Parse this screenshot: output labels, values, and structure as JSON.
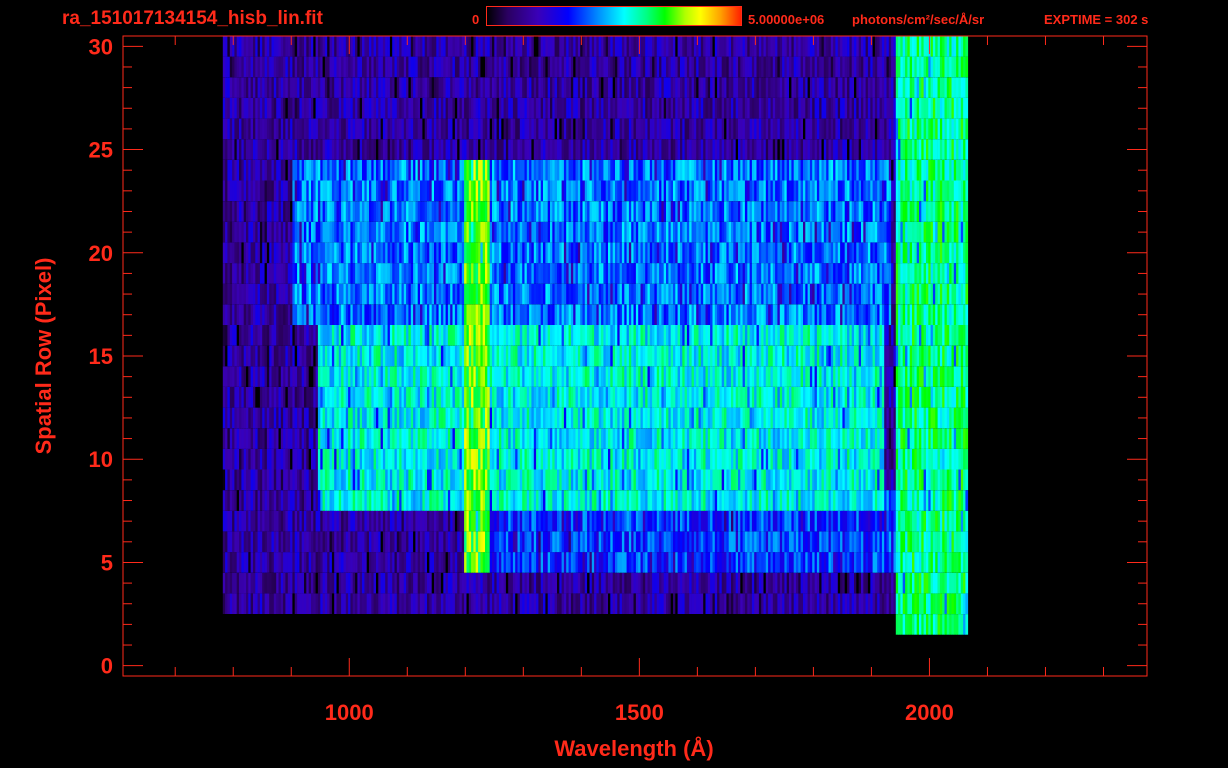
{
  "header": {
    "file_title": "ra_151017134154_hisb_lin.fit",
    "colorbar_min": "0",
    "colorbar_max": "5.00000e+06",
    "colorbar_units": "photons/cm²/sec/Å/sr",
    "exptime": "EXPTIME = 302 s"
  },
  "chart_data": {
    "type": "heatmap",
    "title": "ra_151017134154_hisb_lin.fit",
    "xlabel": "Wavelength (Å)",
    "ylabel": "Spatial Row (Pixel)",
    "xlim": [
      610,
      2375
    ],
    "ylim": [
      -0.5,
      30.5
    ],
    "xticks": [
      1000,
      1500,
      2000
    ],
    "yticks": [
      0,
      5,
      10,
      15,
      20,
      25,
      30
    ],
    "x_minor_step": 100,
    "y_minor_step": 1,
    "colorbar": {
      "min": 0,
      "max": 5000000,
      "units": "photons/cm²/sec/Å/sr",
      "colormap": "rainbow"
    },
    "colors": {
      "axes": "#ff2a1a",
      "background": "#000000"
    },
    "regions": [
      {
        "name": "faint background",
        "rows": [
          3,
          30
        ],
        "wavelength": [
          780,
          2065
        ],
        "level": 0.18
      },
      {
        "name": "upper band",
        "rows": [
          17,
          24
        ],
        "wavelength": [
          900,
          1930
        ],
        "level": 0.42
      },
      {
        "name": "central band",
        "rows": [
          8,
          16
        ],
        "wavelength": [
          945,
          1920
        ],
        "level": 0.55
      },
      {
        "name": "lower band",
        "rows": [
          5,
          8
        ],
        "wavelength": [
          1195,
          1940
        ],
        "level": 0.36
      },
      {
        "name": "bright line",
        "rows": [
          5,
          24
        ],
        "wavelength": [
          1195,
          1240
        ],
        "level": 0.74
      },
      {
        "name": "long-wavelength edge",
        "rows": [
          2,
          30
        ],
        "wavelength": [
          1940,
          2062
        ],
        "level": 0.62
      }
    ]
  }
}
